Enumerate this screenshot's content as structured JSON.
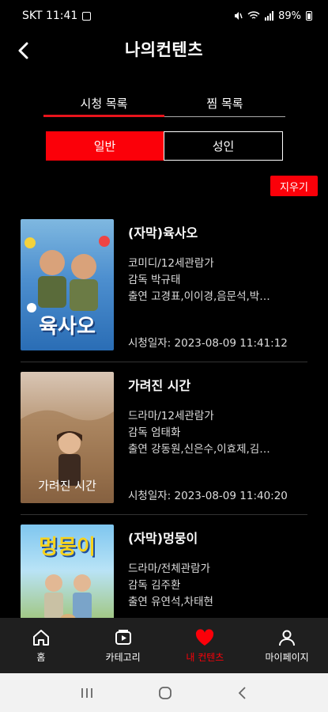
{
  "status_bar": {
    "carrier_time": "SKT 11:41",
    "battery": "89%"
  },
  "header": {
    "title": "나의컨텐츠"
  },
  "tabs": [
    {
      "label": "시청 목록",
      "active": true
    },
    {
      "label": "찜 목록",
      "active": false
    }
  ],
  "segments": [
    {
      "label": "일반",
      "active": true
    },
    {
      "label": "성인",
      "active": false
    }
  ],
  "clear_button": "지우기",
  "items": [
    {
      "title": "(자막)육사오",
      "genre": "코미디/12세관람가",
      "director": "감독 박규태",
      "cast": "출연 고경표,이이경,음문석,박…",
      "watched": "시청일자: 2023-08-09 11:41:12",
      "poster_text": "육사오"
    },
    {
      "title": "가려진 시간",
      "genre": "드라마/12세관람가",
      "director": "감독 엄태화",
      "cast": "출연 강동원,신은수,이효제,김…",
      "watched": "시청일자: 2023-08-09 11:40:20",
      "poster_text": "가려진 시간"
    },
    {
      "title": "(자막)멍뭉이",
      "genre": "드라마/전체관람가",
      "director": "감독 김주환",
      "cast": "출연 유연석,차태현",
      "watched": "",
      "poster_text": "멍뭉이"
    }
  ],
  "bottom_nav": [
    {
      "label": "홈",
      "icon": "home-icon",
      "active": false
    },
    {
      "label": "카테고리",
      "icon": "play-icon",
      "active": false
    },
    {
      "label": "내 컨텐츠",
      "icon": "heart-icon",
      "active": true
    },
    {
      "label": "마이페이지",
      "icon": "person-icon",
      "active": false
    }
  ],
  "colors": {
    "accent": "#fb0009",
    "background": "#000000",
    "nav_background": "#1f1f1f"
  }
}
